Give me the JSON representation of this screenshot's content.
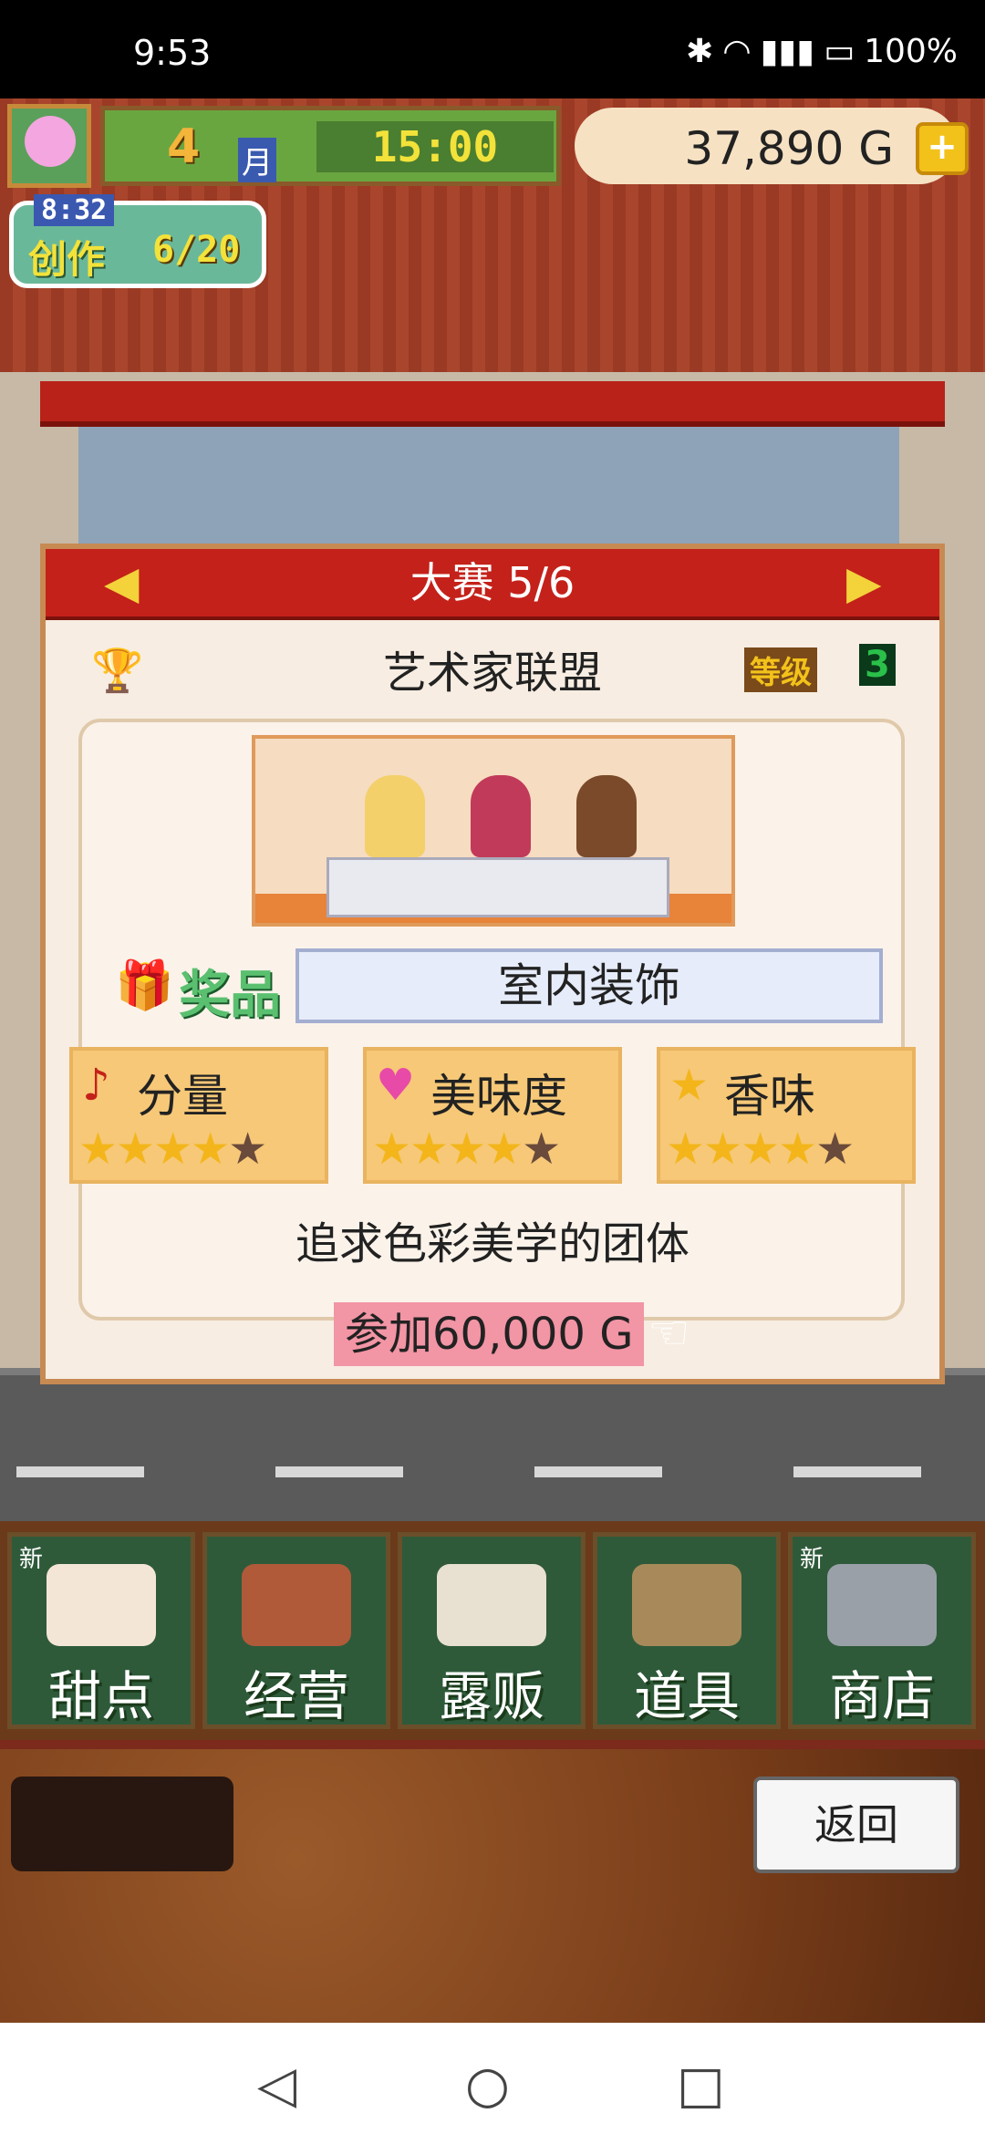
{
  "status_bar": {
    "time": "9:53",
    "icons": [
      "bluetooth-icon",
      "wifi-icon",
      "4g-signal-icon",
      "battery-icon"
    ],
    "battery": "100%"
  },
  "hud": {
    "month_number": "4",
    "month_char": "月",
    "clock": "15:00",
    "money": "37,890 G",
    "craft_timer": "8:32",
    "craft_label": "创作",
    "craft_count": "6/20"
  },
  "dialog": {
    "title": "大赛 5/6",
    "team_name": "艺术家联盟",
    "rank_label": "等级",
    "rank_value": "3",
    "prize_label": "奖品",
    "prize_value": "室内装饰",
    "stats": [
      {
        "icon": "music-note-icon",
        "label": "分量",
        "stars": 4,
        "max": 5
      },
      {
        "icon": "heart-icon",
        "label": "美味度",
        "stars": 4,
        "max": 5
      },
      {
        "icon": "star-icon",
        "label": "香味",
        "stars": 4,
        "max": 5
      }
    ],
    "description": "追求色彩美学的团体",
    "entry_cost": "参加60,000 G"
  },
  "menu": {
    "items": [
      {
        "label": "甜点",
        "new": "新"
      },
      {
        "label": "经营",
        "new": ""
      },
      {
        "label": "露贩",
        "new": ""
      },
      {
        "label": "道具",
        "new": ""
      },
      {
        "label": "商店",
        "new": "新"
      }
    ]
  },
  "footer": {
    "back_label": "返回"
  },
  "colors": {
    "dialog_header": "#c4211a",
    "menu_bg": "#2e5a3a",
    "star_on": "#f3b51a",
    "cost_highlight": "#f295a5"
  }
}
